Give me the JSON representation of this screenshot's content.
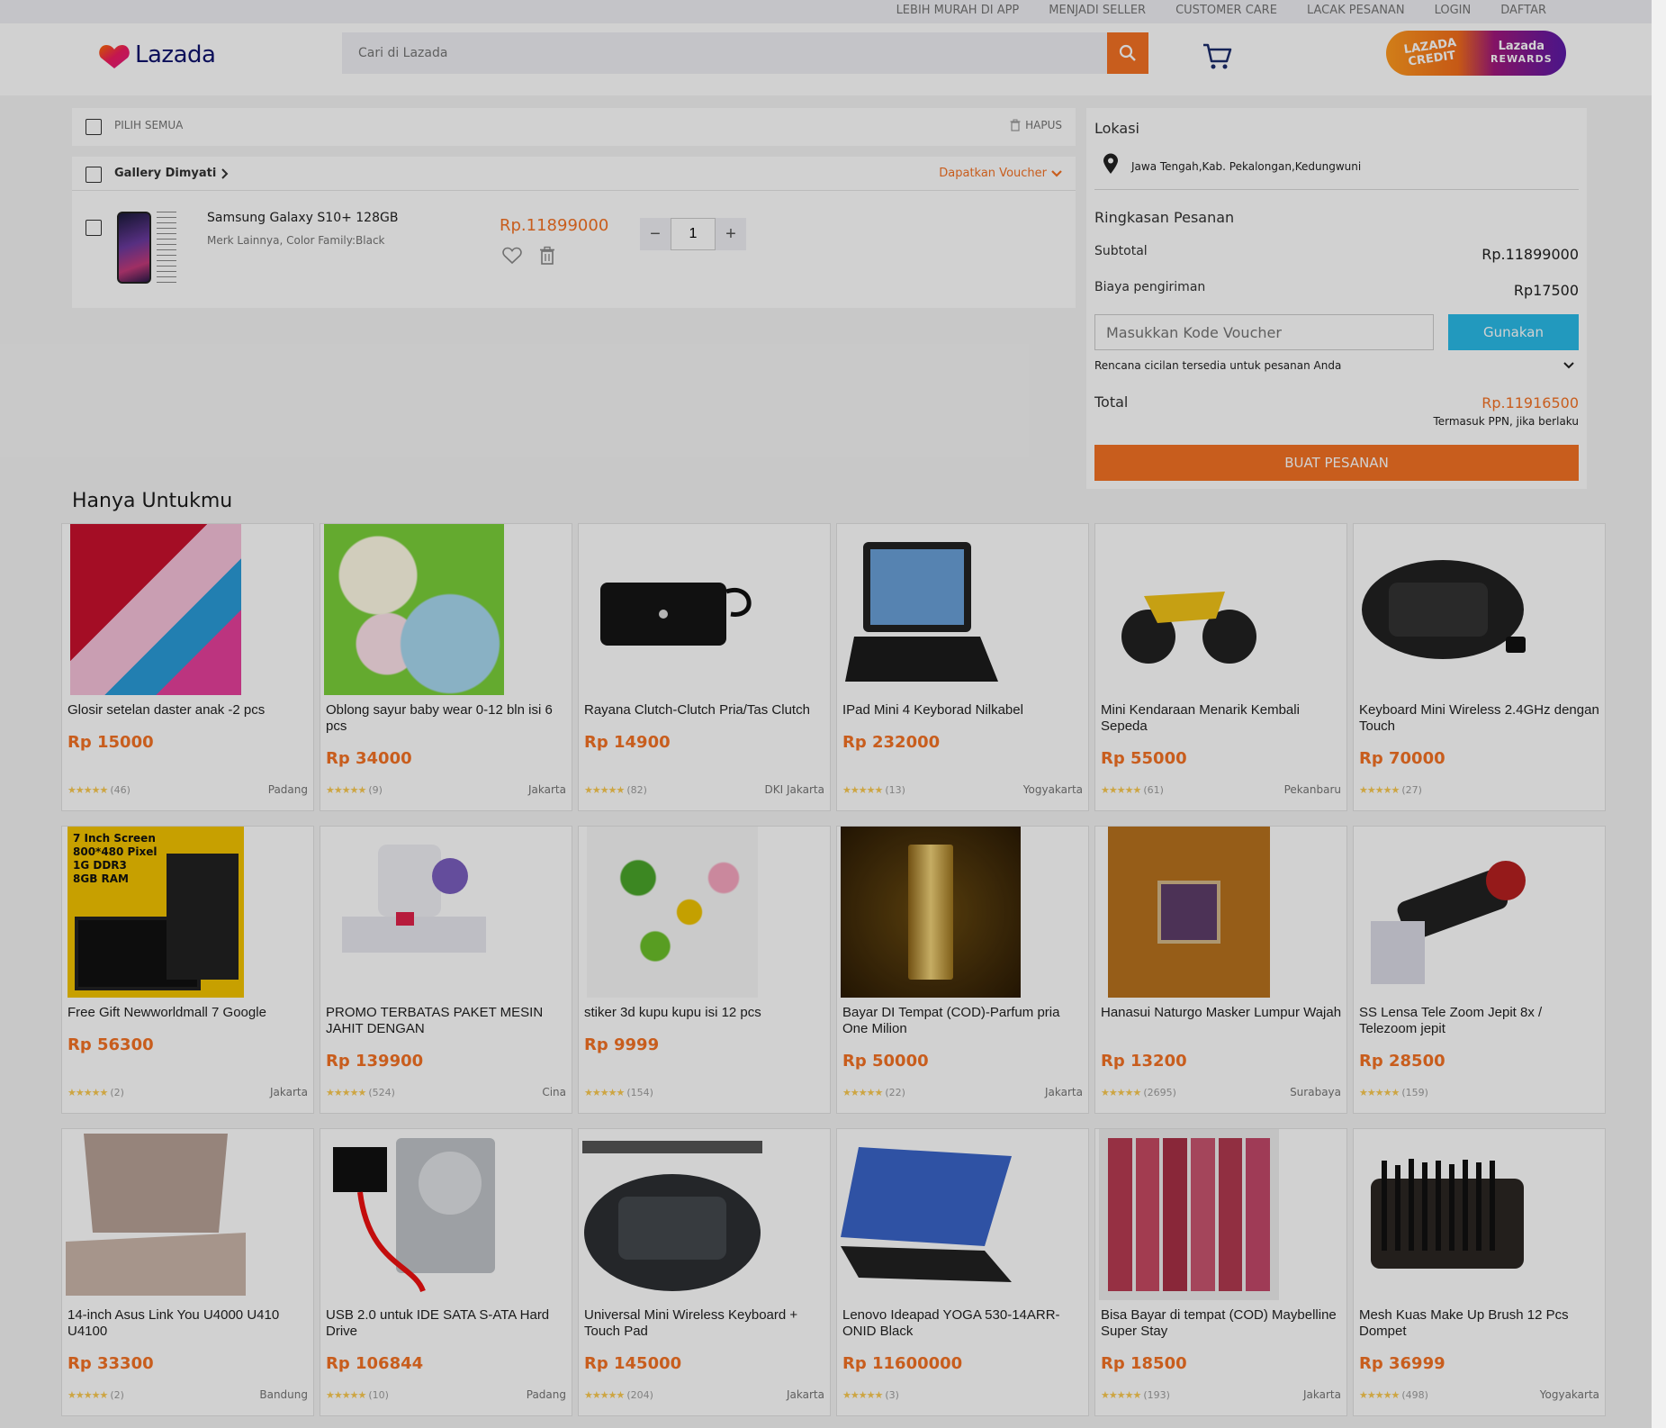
{
  "topnav": [
    "LEBIH MURAH DI APP",
    "MENJADI SELLER",
    "CUSTOMER CARE",
    "LACAK PESANAN",
    "LOGIN",
    "DAFTAR"
  ],
  "header": {
    "logo_text": "Lazada",
    "search_placeholder": "Cari di Lazada",
    "rewards_left": "LAZADA CREDIT",
    "rewards_right_1": "Lazada",
    "rewards_right_2": "REWARDS"
  },
  "cart": {
    "select_all": "PILIH SEMUA",
    "delete": "HAPUS",
    "seller": "Gallery Dimyati",
    "voucher_link": "Dapatkan Voucher",
    "item": {
      "name": "Samsung Galaxy S10+ 128GB",
      "variant": "Merk Lainnya, Color Family:Black",
      "price": "Rp.11899000",
      "qty": "1"
    }
  },
  "summary": {
    "location_title": "Lokasi",
    "location": "Jawa Tengah,Kab. Pekalongan,Kedungwuni",
    "title": "Ringkasan Pesanan",
    "subtotal_label": "Subtotal",
    "subtotal": "Rp.11899000",
    "shipping_label": "Biaya pengiriman",
    "shipping": "Rp17500",
    "voucher_placeholder": "Masukkan Kode Voucher",
    "apply": "Gunakan",
    "installment": "Rencana cicilan tersedia untuk pesanan Anda",
    "total_label": "Total",
    "total": "Rp.11916500",
    "tax_note": "Termasuk PPN, jika berlaku",
    "checkout": "BUAT PESANAN"
  },
  "recommend": {
    "title": "Hanya Untukmu",
    "products": [
      {
        "title": "Glosir setelan daster anak -2 pcs",
        "price": "Rp 15000",
        "reviews": "(46)",
        "location": "Padang",
        "img": "clothes-red",
        "twoline": false
      },
      {
        "title": "Oblong sayur baby wear 0-12 bln isi 6 pcs",
        "price": "Rp 34000",
        "reviews": "(9)",
        "location": "Jakarta",
        "img": "baby-shirts",
        "twoline": true
      },
      {
        "title": "Rayana Clutch-Clutch Pria/Tas Clutch",
        "price": "Rp 14900",
        "reviews": "(82)",
        "location": "DKI Jakarta",
        "img": "clutch",
        "twoline": false
      },
      {
        "title": "IPad Mini 4 Keyborad Nilkabel",
        "price": "Rp 232000",
        "reviews": "(13)",
        "location": "Yogyakarta",
        "img": "tablet-keyboard",
        "twoline": false
      },
      {
        "title": "Mini Kendaraan Menarik Kembali Sepeda",
        "price": "Rp 55000",
        "reviews": "(61)",
        "location": "Pekanbaru",
        "img": "toy-bike",
        "twoline": true
      },
      {
        "title": "Keyboard Mini Wireless 2.4GHz dengan Touch",
        "price": "Rp 70000",
        "reviews": "(27)",
        "location": "",
        "img": "mini-keyboard",
        "twoline": true
      },
      {
        "title": "Free Gift Newworldmall 7 Google",
        "price": "Rp 56300",
        "reviews": "(2)",
        "location": "Jakarta",
        "img": "android-tablet",
        "twoline": false
      },
      {
        "title": "PROMO TERBATAS PAKET MESIN JAHIT DENGAN",
        "price": "Rp 139900",
        "reviews": "(524)",
        "location": "Cina",
        "img": "sewing-machine",
        "twoline": true
      },
      {
        "title": "stiker 3d kupu kupu isi 12 pcs",
        "price": "Rp 9999",
        "reviews": "(154)",
        "location": "",
        "img": "butterflies",
        "twoline": false
      },
      {
        "title": "Bayar DI Tempat (COD)-Parfum pria One Milion",
        "price": "Rp 50000",
        "reviews": "(22)",
        "location": "Jakarta",
        "img": "perfume",
        "twoline": true
      },
      {
        "title": "Hanasui Naturgo Masker Lumpur Wajah",
        "price": "Rp 13200",
        "reviews": "(2695)",
        "location": "Surabaya",
        "img": "mask-sachet",
        "twoline": true
      },
      {
        "title": "SS Lensa Tele Zoom Jepit 8x / Telezoom jepit",
        "price": "Rp 28500",
        "reviews": "(159)",
        "location": "",
        "img": "tele-lens",
        "twoline": true
      },
      {
        "title": "14-inch Asus Link You U4000 U410 U4100",
        "price": "Rp 33300",
        "reviews": "(2)",
        "location": "Bandung",
        "img": "laptop-asus",
        "twoline": true
      },
      {
        "title": "USB 2.0 untuk IDE SATA S-ATA Hard Drive",
        "price": "Rp 106844",
        "reviews": "(10)",
        "location": "Padang",
        "img": "hdd-cable",
        "twoline": true
      },
      {
        "title": "Universal Mini Wireless Keyboard + Touch Pad",
        "price": "Rp 145000",
        "reviews": "(204)",
        "location": "Jakarta",
        "img": "mini-keyboard-2",
        "twoline": true
      },
      {
        "title": "Lenovo Ideapad YOGA 530-14ARR-ONID Black",
        "price": "Rp 11600000",
        "reviews": "(3)",
        "location": "",
        "img": "laptop-yoga",
        "twoline": true
      },
      {
        "title": "Bisa Bayar di tempat (COD) Maybelline Super Stay",
        "price": "Rp 18500",
        "reviews": "(193)",
        "location": "Jakarta",
        "img": "lipsticks",
        "twoline": true
      },
      {
        "title": "Mesh Kuas Make Up Brush 12 Pcs Dompet",
        "price": "Rp 36999",
        "reviews": "(498)",
        "location": "Yogyakarta",
        "img": "brush-set",
        "twoline": true
      }
    ]
  },
  "colors": {
    "brand_orange": "#f57224",
    "apply_teal": "#2abbe8"
  }
}
